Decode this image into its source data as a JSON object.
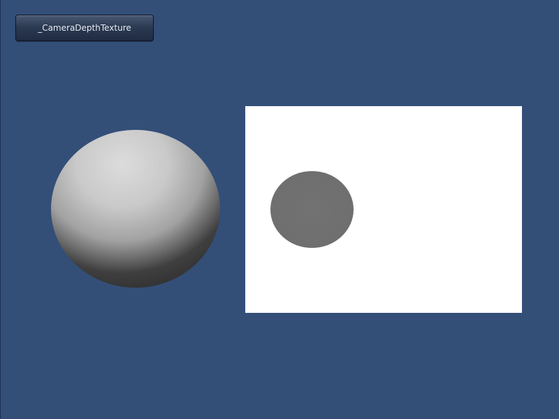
{
  "toolbar": {
    "texture_button_label": "_CameraDepthTexture"
  },
  "scene": {
    "background_color": "#334f78",
    "sphere_color": "#c8c8c8",
    "depth_panel_color": "#ffffff",
    "depth_blob_color": "#707070"
  }
}
